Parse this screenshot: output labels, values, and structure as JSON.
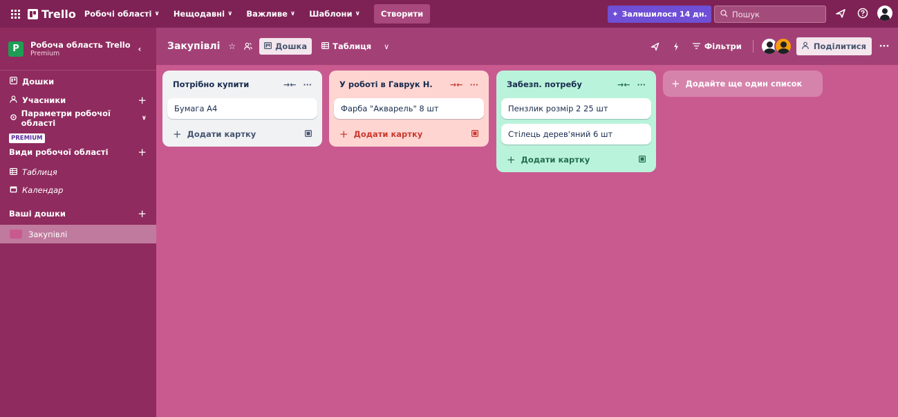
{
  "colors": {
    "topbar": "#7e2255",
    "sidebar": "#8f2b5e",
    "board_bg": "#c95a90",
    "board_header": "#a34177",
    "trial_button": "#6e4fd6",
    "list_default": "#f1f2f4",
    "list_red": "#ffd5d2",
    "list_green": "#baf3db",
    "accent_red": "#c9372c"
  },
  "topbar": {
    "apps_icon": "grid-icon",
    "logo_text": "Trello",
    "nav": [
      {
        "label": "Робочі області"
      },
      {
        "label": "Нещодавні"
      },
      {
        "label": "Важливе"
      },
      {
        "label": "Шаблони"
      }
    ],
    "create_label": "Створити",
    "trial_label": "Залишилося 14 дн.",
    "search_placeholder": "Пошук"
  },
  "sidebar": {
    "workspace_letter": "P",
    "workspace_name": "Робоча область Trello",
    "workspace_plan": "Premium",
    "items": [
      {
        "label": "Дошки",
        "icon": "board-icon"
      },
      {
        "label": "Учасники",
        "icon": "person-icon"
      },
      {
        "label": "Параметри робочої області",
        "icon": "gear-icon"
      }
    ],
    "premium_tag": "PREMIUM",
    "views_header": "Види робочої області",
    "views": [
      {
        "label": "Таблиця",
        "icon": "table-icon"
      },
      {
        "label": "Календар",
        "icon": "calendar-icon"
      }
    ],
    "boards_header": "Ваші дошки",
    "boards": [
      {
        "label": "Закупівлі"
      }
    ]
  },
  "board": {
    "title": "Закупівлі",
    "view_board": "Дошка",
    "view_table": "Таблиця",
    "filters_label": "Фільтри",
    "share_label": "Поділитися"
  },
  "lists": [
    {
      "title": "Потрібно купити",
      "cards": [
        "Бумага А4"
      ],
      "add_label": "Додати картку"
    },
    {
      "title": "У роботі в Гаврук Н.",
      "cards": [
        "Фарба \"Акварель\" 8 шт"
      ],
      "add_label": "Додати картку"
    },
    {
      "title": "Забезп. потребу",
      "cards": [
        "Пензлик розмір 2 25 шт",
        "Стілець дерев'яний 6 шт"
      ],
      "add_label": "Додати картку"
    }
  ],
  "add_list_label": "Додайте ще один список"
}
